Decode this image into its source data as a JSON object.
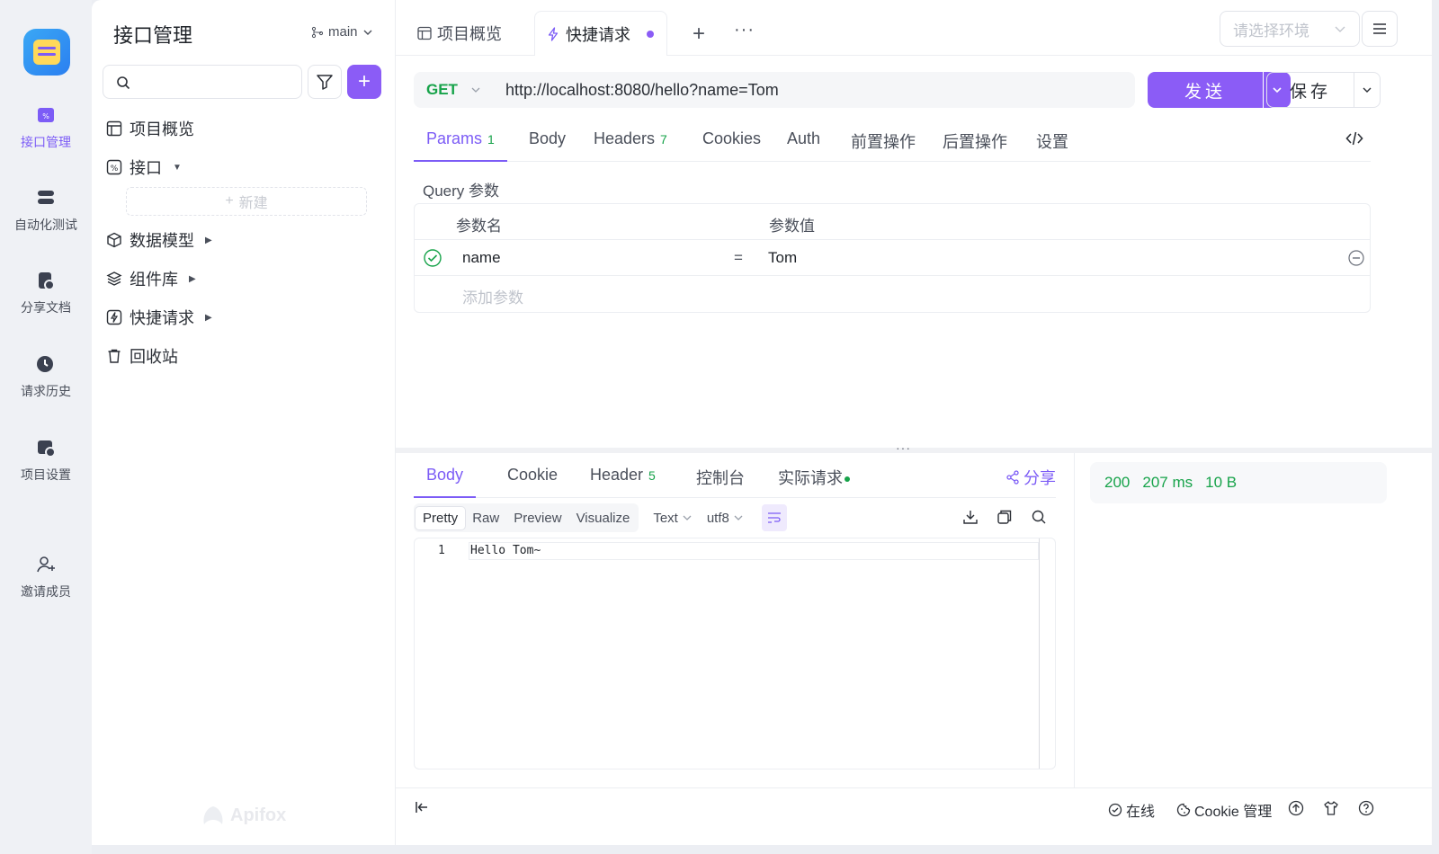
{
  "rail": {
    "items": [
      {
        "label": "接口管理",
        "icon": "api-icon",
        "active": true
      },
      {
        "label": "自动化测试",
        "icon": "automation-icon"
      },
      {
        "label": "分享文档",
        "icon": "share-doc-icon"
      },
      {
        "label": "请求历史",
        "icon": "history-icon"
      },
      {
        "label": "项目设置",
        "icon": "project-settings-icon"
      },
      {
        "label": "邀请成员",
        "icon": "invite-member-icon"
      }
    ]
  },
  "sidebar": {
    "title": "接口管理",
    "branch": "main",
    "tree": [
      {
        "label": "项目概览",
        "icon": "overview-icon"
      },
      {
        "label": "接口",
        "icon": "api-folder-icon"
      },
      {
        "label": "数据模型",
        "icon": "model-icon"
      },
      {
        "label": "组件库",
        "icon": "components-icon"
      },
      {
        "label": "快捷请求",
        "icon": "quick-request-icon"
      },
      {
        "label": "回收站",
        "icon": "trash-icon"
      }
    ],
    "new_label": "新建",
    "watermark": "Apifox"
  },
  "tabs": {
    "overview": "项目概览",
    "quick": "快捷请求"
  },
  "env": {
    "placeholder": "请选择环境"
  },
  "request": {
    "method": "GET",
    "url": "http://localhost:8080/hello?name=Tom",
    "send": "发送",
    "save": "保存"
  },
  "req_tabs": [
    {
      "label": "Params",
      "badge": "1"
    },
    {
      "label": "Body",
      "badge": ""
    },
    {
      "label": "Headers",
      "badge": "7"
    },
    {
      "label": "Cookies",
      "badge": ""
    },
    {
      "label": "Auth",
      "badge": ""
    },
    {
      "label": "前置操作",
      "badge": ""
    },
    {
      "label": "后置操作",
      "badge": ""
    },
    {
      "label": "设置",
      "badge": ""
    }
  ],
  "params": {
    "section_label": "Query 参数",
    "col_name": "参数名",
    "col_value": "参数值",
    "rows": [
      {
        "name": "name",
        "value": "Tom",
        "enabled": true
      }
    ],
    "add_placeholder": "添加参数",
    "equals": "="
  },
  "response": {
    "tabs": [
      {
        "label": "Body",
        "badge": ""
      },
      {
        "label": "Cookie",
        "badge": ""
      },
      {
        "label": "Header",
        "badge": "5"
      },
      {
        "label": "控制台",
        "badge": ""
      },
      {
        "label": "实际请求",
        "badge": ""
      }
    ],
    "share": "分享",
    "formats": [
      "Pretty",
      "Raw",
      "Preview",
      "Visualize"
    ],
    "type": "Text",
    "encoding": "utf8",
    "line_number": "1",
    "body_text": "Hello Tom~",
    "status": "200",
    "time": "207 ms",
    "size": "10 B"
  },
  "footer": {
    "online": "在线",
    "cookie_manage": "Cookie 管理"
  },
  "colors": {
    "accent": "#8b5cf6",
    "success": "#17a34a"
  }
}
